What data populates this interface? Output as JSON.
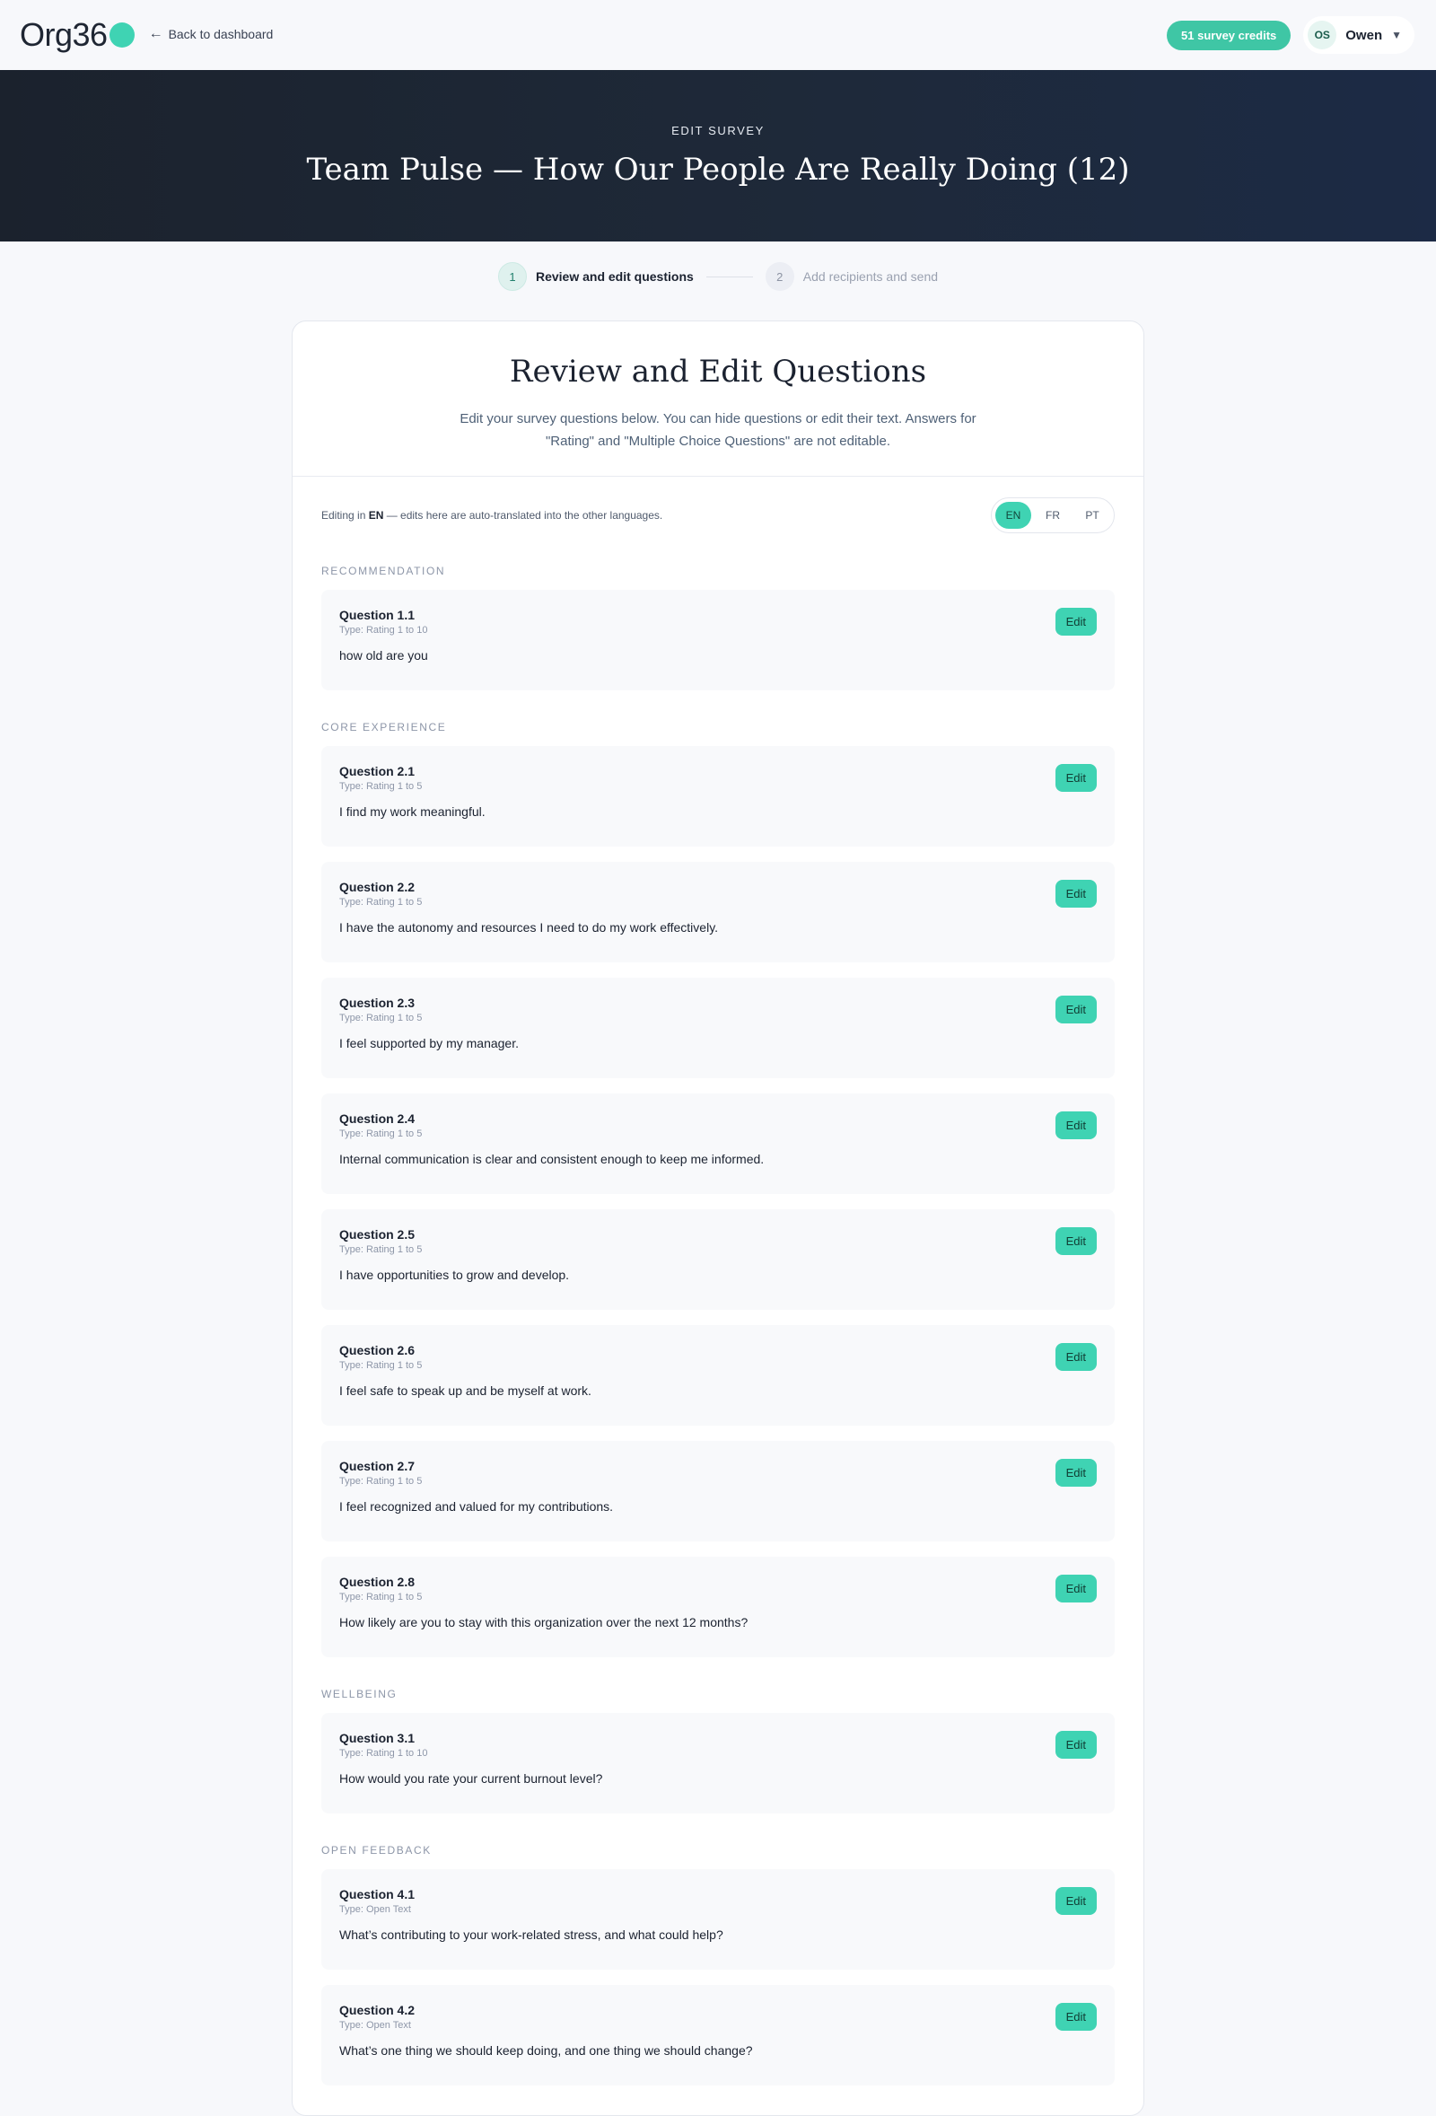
{
  "header": {
    "logo_text": "Org36",
    "back_label": "Back to dashboard",
    "credits_label": "51 survey credits",
    "user_initials": "OS",
    "user_name": "Owen"
  },
  "hero": {
    "eyebrow": "EDIT SURVEY",
    "title": "Team Pulse — How Our People Are Really Doing (12)"
  },
  "stepper": {
    "steps": [
      {
        "num": "1",
        "label": "Review and edit questions"
      },
      {
        "num": "2",
        "label": "Add recipients and send"
      }
    ]
  },
  "card": {
    "title": "Review and Edit Questions",
    "subtitle": "Edit your survey questions below. You can hide questions or edit their text. Answers for \"Rating\" and \"Multiple Choice Questions\" are not editable.",
    "lang_note_prefix": "Editing in ",
    "lang_note_lang": "EN",
    "lang_note_suffix": " — edits here are auto-translated into the other languages.",
    "languages": [
      "EN",
      "FR",
      "PT"
    ],
    "active_language": "EN",
    "edit_label": "Edit"
  },
  "sections": [
    {
      "label": "RECOMMENDATION",
      "questions": [
        {
          "title": "Question 1.1",
          "type": "Type: Rating 1 to 10",
          "text": "how old are you"
        }
      ]
    },
    {
      "label": "CORE EXPERIENCE",
      "questions": [
        {
          "title": "Question 2.1",
          "type": "Type: Rating 1 to 5",
          "text": "I find my work meaningful."
        },
        {
          "title": "Question 2.2",
          "type": "Type: Rating 1 to 5",
          "text": "I have the autonomy and resources I need to do my work effectively."
        },
        {
          "title": "Question 2.3",
          "type": "Type: Rating 1 to 5",
          "text": "I feel supported by my manager."
        },
        {
          "title": "Question 2.4",
          "type": "Type: Rating 1 to 5",
          "text": "Internal communication is clear and consistent enough to keep me informed."
        },
        {
          "title": "Question 2.5",
          "type": "Type: Rating 1 to 5",
          "text": "I have opportunities to grow and develop."
        },
        {
          "title": "Question 2.6",
          "type": "Type: Rating 1 to 5",
          "text": "I feel safe to speak up and be myself at work."
        },
        {
          "title": "Question 2.7",
          "type": "Type: Rating 1 to 5",
          "text": "I feel recognized and valued for my contributions."
        },
        {
          "title": "Question 2.8",
          "type": "Type: Rating 1 to 5",
          "text": "How likely are you to stay with this organization over the next 12 months?"
        }
      ]
    },
    {
      "label": "WELLBEING",
      "questions": [
        {
          "title": "Question 3.1",
          "type": "Type: Rating 1 to 10",
          "text": "How would you rate your current burnout level?"
        }
      ]
    },
    {
      "label": "OPEN FEEDBACK",
      "questions": [
        {
          "title": "Question 4.1",
          "type": "Type: Open Text",
          "text": "What’s contributing to your work-related stress, and what could help?"
        },
        {
          "title": "Question 4.2",
          "type": "Type: Open Text",
          "text": "What’s one thing we should keep doing, and one thing we should change?"
        }
      ]
    }
  ],
  "colors": {
    "accent": "#3fd3b3",
    "credits": "#3fc6a5",
    "hero_bg": "#1e2939"
  }
}
